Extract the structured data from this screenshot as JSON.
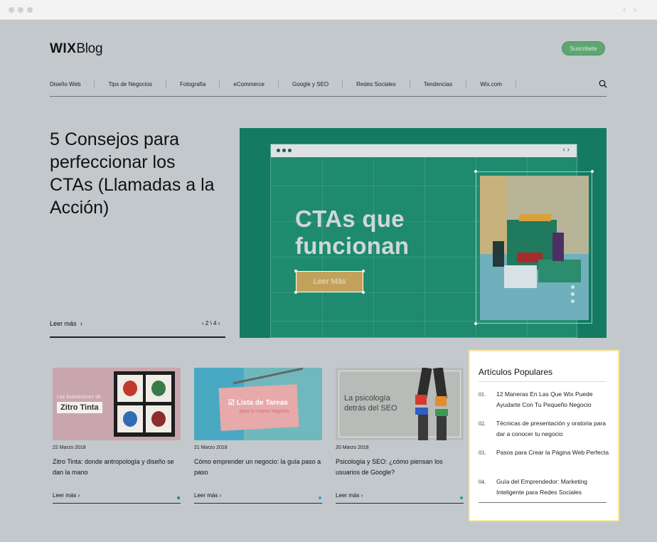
{
  "logo": {
    "brand": "WIX",
    "product": "Blog"
  },
  "header": {
    "subscribe_label": "Suscribete"
  },
  "nav": {
    "items": [
      "Diseño Web",
      "Tips de Negocios",
      "Fotografía",
      "eCommerce",
      "Google y SEO",
      "Redes Sociales",
      "Tendencias",
      "Wix.com"
    ]
  },
  "hero": {
    "title": "5 Consejos para perfeccionar los CTAs (Llamadas a la Acción)",
    "read_more": "Leer más",
    "pager": "2 \\ 4",
    "image": {
      "headline_line1": "CTAs que",
      "headline_line2": "funcionan",
      "button_label": "Leer Más"
    }
  },
  "cards": [
    {
      "overlay_small": "Las ilustraciones de",
      "overlay_big": "Zitro Tinta",
      "date": "22 Marzo 2018",
      "title": "Zitro Tinta: donde antropología y diseño se dan la mano",
      "read_more": "Leer más",
      "accent": "#2e8b57"
    },
    {
      "overlay_big": "Lista de Tareas",
      "overlay_small": "para tu nuevo negocio",
      "date": "21 Marzo 2018",
      "title": "Cómo emprender un negocio: la guía paso a paso",
      "read_more": "Leer más",
      "accent": "#3aa0c8"
    },
    {
      "overlay_line1": "La psicología",
      "overlay_line2": "detrás del SEO",
      "date": "20 Marzo 2018",
      "title": "Psicología y SEO: ¿cómo piensan los usuarios de Google?",
      "read_more": "Leer más",
      "accent": "#2a9d8f"
    }
  ],
  "popular": {
    "title": "Artículos Populares",
    "items": [
      {
        "num": "01.",
        "text": "12 Maneras En Las Que Wix Puede Ayudarte Con Tu Pequeño Negocio"
      },
      {
        "num": "02.",
        "text": "Técnicas de presentación y oratoria para dar a conocer tu negocio"
      },
      {
        "num": "03.",
        "text": "Pasos para Crear la Página Web Perfecta"
      },
      {
        "num": "04.",
        "text": "Guía del Emprendedor: Marketing Inteligente para Redes Sociales"
      }
    ]
  },
  "icons": {
    "search": "search-icon",
    "chevron_right": "chevron-right-icon"
  },
  "colors": {
    "page_background": "#c3c8cc",
    "hero_green": "#157a62",
    "subscribe_green": "#5fa672",
    "cta_gold": "#c2a25a",
    "popular_highlight": "#fbe8a0"
  }
}
